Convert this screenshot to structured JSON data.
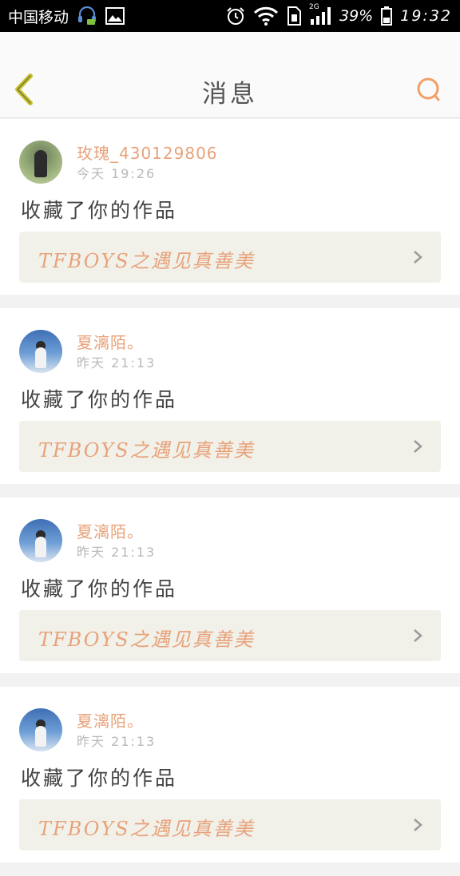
{
  "status_bar": {
    "carrier": "中国移动",
    "battery": "39%",
    "time": "19:32",
    "network": "2G"
  },
  "header": {
    "title": "消息"
  },
  "messages": [
    {
      "username": "玫瑰_430129806",
      "time": "今天 19:26",
      "action": "收藏了你的作品",
      "work_title": "TFBOYS之遇见真善美"
    },
    {
      "username": "夏漓陌。",
      "time": "昨天 21:13",
      "action": "收藏了你的作品",
      "work_title": "TFBOYS之遇见真善美"
    },
    {
      "username": "夏漓陌。",
      "time": "昨天 21:13",
      "action": "收藏了你的作品",
      "work_title": "TFBOYS之遇见真善美"
    },
    {
      "username": "夏漓陌。",
      "time": "昨天 21:13",
      "action": "收藏了你的作品",
      "work_title": "TFBOYS之遇见真善美"
    }
  ],
  "colors": {
    "accent": "#e8a27a",
    "back_arrow": "#c9c235",
    "link_background": "#f1f1ea"
  },
  "icons": [
    "back-arrow-icon",
    "search-icon",
    "chevron-right-icon",
    "headset-icon",
    "image-icon",
    "alarm-icon",
    "wifi-icon",
    "sim-icon",
    "signal-icon",
    "battery-icon"
  ]
}
